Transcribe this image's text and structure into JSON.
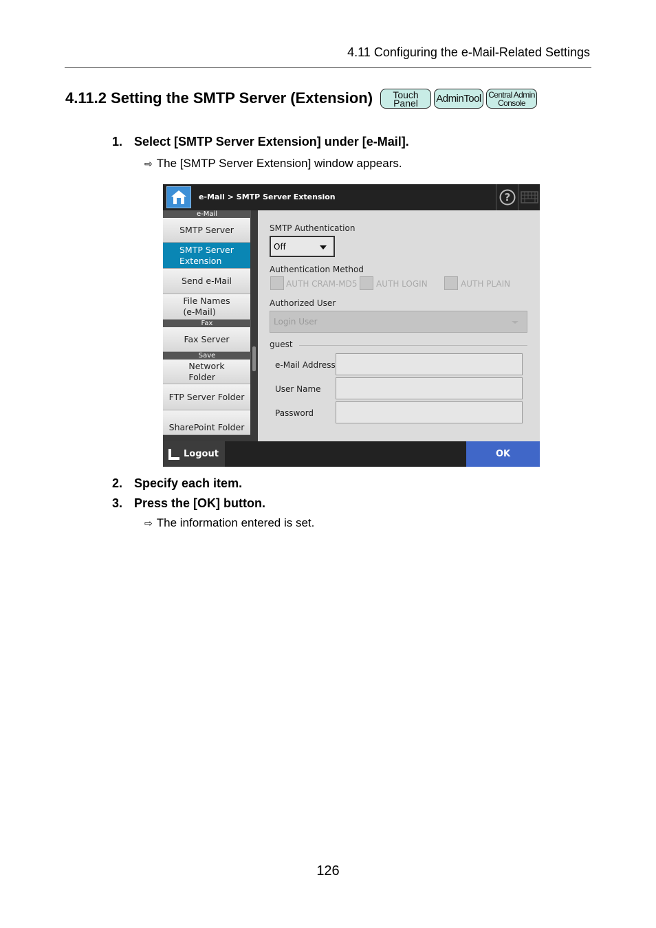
{
  "header": {
    "chapter_title": "4.11 Configuring the e-Mail-Related Settings"
  },
  "section": {
    "title": "4.11.2 Setting the SMTP Server (Extension)",
    "badges": [
      {
        "line1": "Touch",
        "line2": "Panel"
      },
      {
        "line1": "AdminTool",
        "line2": ""
      },
      {
        "line1": "Central Admin",
        "line2": "Console"
      }
    ]
  },
  "steps": [
    {
      "num": "1.",
      "text": "Select [SMTP Server Extension] under [e-Mail].",
      "result": "The [SMTP Server Extension] window appears."
    },
    {
      "num": "2.",
      "text": "Specify each item."
    },
    {
      "num": "3.",
      "text": "Press the [OK] button.",
      "result": "The information entered is set."
    }
  ],
  "screen": {
    "breadcrumb": "e-Mail  >  SMTP Server Extension",
    "sidebar": {
      "groups": [
        "e-Mail",
        "Fax",
        "Save"
      ],
      "items": [
        {
          "label": "SMTP Server"
        },
        {
          "label": "SMTP Server Extension",
          "l1": "SMTP Server",
          "l2": "Extension",
          "active": true
        },
        {
          "label": "Send e-Mail"
        },
        {
          "label": "File Names (e-Mail)",
          "l1": "File Names",
          "l2": "(e-Mail)"
        },
        {
          "label": "Fax Server"
        },
        {
          "label": "Network Folder",
          "l1": "Network",
          "l2": "Folder"
        },
        {
          "label": "FTP Server Folder"
        },
        {
          "label": "SharePoint Folder"
        }
      ]
    },
    "form": {
      "smtp_auth_label": "SMTP Authentication",
      "smtp_auth_value": "Off",
      "auth_method_label": "Authentication Method",
      "auth_methods": [
        "AUTH CRAM-MD5",
        "AUTH LOGIN",
        "AUTH PLAIN"
      ],
      "authorized_user_label": "Authorized User",
      "authorized_user_value": "Login User",
      "guest_label": "guest",
      "email_label": "e-Mail Address",
      "email_value": "",
      "username_label": "User Name",
      "username_value": "",
      "password_label": "Password",
      "password_value": ""
    },
    "logout_label": "Logout",
    "ok_label": "OK"
  },
  "page_number": "126"
}
